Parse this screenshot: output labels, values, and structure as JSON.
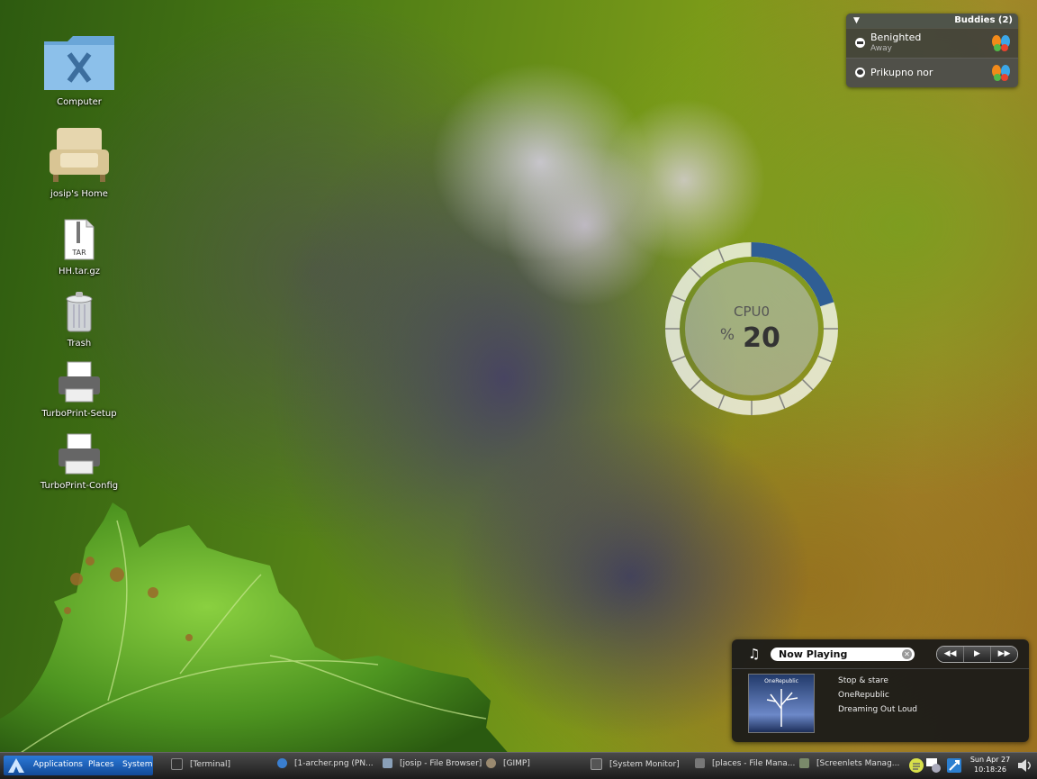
{
  "desktop": {
    "icons": [
      {
        "label": "Computer"
      },
      {
        "label": "josip's Home"
      },
      {
        "label": "HH.tar.gz",
        "badge": "TAR"
      },
      {
        "label": "Trash"
      },
      {
        "label": "TurboPrint-Setup"
      },
      {
        "label": "TurboPrint-Config"
      }
    ]
  },
  "buddies": {
    "title": "Buddies (2)",
    "list": [
      {
        "name": "Benighted",
        "status": "Away"
      },
      {
        "name": "Prikupno nor",
        "status": ""
      }
    ]
  },
  "cpu": {
    "label": "CPU0",
    "unit": "%",
    "value": "20",
    "fraction": 0.2,
    "accent": "#2f5e94"
  },
  "now_playing": {
    "title": "Now Playing",
    "track": "Stop & stare",
    "artist": "OneRepublic",
    "album": "Dreaming Out Loud",
    "cover_text": "OneRepublic"
  },
  "taskbar": {
    "menus": {
      "applications": "Applications",
      "places": "Places",
      "system": "System"
    },
    "tasks": [
      {
        "label": "[Terminal]"
      },
      {
        "label": "[1-archer.png (PN..."
      },
      {
        "label": "[josip - File Browser]"
      },
      {
        "label": "[GIMP]"
      },
      {
        "label": "[System Monitor]"
      },
      {
        "label": "[places - File Mana..."
      },
      {
        "label": "[Screenlets Manag..."
      }
    ],
    "clock": {
      "date": "Sun Apr 27",
      "time": "10:18:26"
    }
  }
}
